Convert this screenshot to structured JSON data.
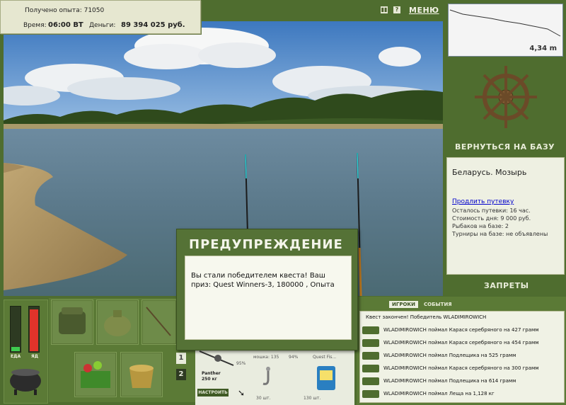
{
  "info": {
    "xp_text": "Получено опыта: 71050",
    "time_label": "Время:",
    "time_value": "06:00 ВТ",
    "money_label": "Деньги:",
    "money_value": "89 394 025 руб."
  },
  "top_controls": {
    "pause_icon": "pause-icon",
    "help_icon": "help-icon",
    "menu_label": "МЕНЮ"
  },
  "depth": {
    "value": "4,34 m"
  },
  "base": {
    "return_label": "ВЕРНУТЬСЯ НА БАЗУ",
    "location": "Беларусь. Мозырь",
    "extend_link": "Продлить путевку",
    "lines": [
      "Осталось путевки: 16 час.",
      "Стоимость дня: 9 000 руб.",
      "Рыбаков на базе: 2",
      "Турниры на базе: не объявлены"
    ],
    "bans_label": "ЗАПРЕТЫ"
  },
  "meters": {
    "food_label": "ЕДА",
    "poison_label": "ЯД",
    "food_level": 0.1,
    "poison_level": 0.95
  },
  "inventory": {
    "pages": [
      "1",
      "2"
    ]
  },
  "tackle": {
    "rod_name": "Panther",
    "rod_weight": "250 кг",
    "rod_percent": "95%",
    "slot2_text": "мошка: 135",
    "slot2_percent": "94%",
    "slot3_text": "Quest Fis...",
    "slot2_count": "30 шт.",
    "slot3_count": "130 шт.",
    "tune_label": "НАСТРОИТЬ"
  },
  "events": {
    "tab_players": "ИГРОКИ",
    "tab_events": "СОБЫТИЯ",
    "header": "Квест закончен! Победитель WLADIMIROWICH",
    "rows": [
      "WLADIMIROWICH поймал Карася серебряного на 427 грамм",
      "WLADIMIROWICH поймал Карася серебряного на 454 грамм",
      "WLADIMIROWICH поймал Подлещика на 525 грамм",
      "WLADIMIROWICH поймал Карася серебряного на 300 грамм",
      "WLADIMIROWICH поймал Подлещика на 614 грамм",
      "WLADIMIROWICH поймал Леща на 1,128 кг"
    ]
  },
  "dialog": {
    "title": "ПРЕДУПРЕЖДЕНИЕ",
    "text": "Вы стали победителем квеста! Ваш приз: Quest Winners-3, 180000 , Опыта"
  },
  "colors": {
    "panel_green": "#4f6d2f",
    "panel_light": "#eef0e2",
    "meter_food": "#3ecb4f",
    "meter_poison": "#e1332a"
  }
}
